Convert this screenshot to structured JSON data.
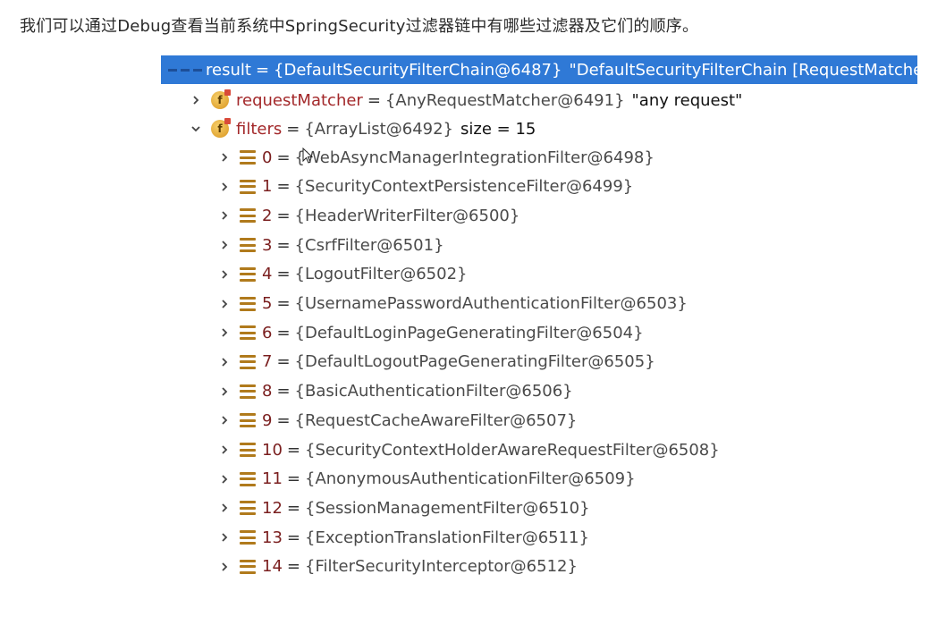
{
  "caption": "我们可以通过Debug查看当前系统中SpringSecurity过滤器链中有哪些过滤器及它们的顺序。",
  "result": {
    "name": "result",
    "value": "{DefaultSecurityFilterChain@6487}",
    "extra": "\"DefaultSecurityFilterChain [RequestMatche"
  },
  "request_matcher": {
    "name": "requestMatcher",
    "value": "{AnyRequestMatcher@6491}",
    "extra": "\"any request\""
  },
  "filters": {
    "name": "filters",
    "value": "{ArrayList@6492}",
    "extra": "size = 15",
    "items": [
      {
        "index": "0",
        "value": "{WebAsyncManagerIntegrationFilter@6498}"
      },
      {
        "index": "1",
        "value": "{SecurityContextPersistenceFilter@6499}"
      },
      {
        "index": "2",
        "value": "{HeaderWriterFilter@6500}"
      },
      {
        "index": "3",
        "value": "{CsrfFilter@6501}"
      },
      {
        "index": "4",
        "value": "{LogoutFilter@6502}"
      },
      {
        "index": "5",
        "value": "{UsernamePasswordAuthenticationFilter@6503}"
      },
      {
        "index": "6",
        "value": "{DefaultLoginPageGeneratingFilter@6504}"
      },
      {
        "index": "7",
        "value": "{DefaultLogoutPageGeneratingFilter@6505}"
      },
      {
        "index": "8",
        "value": "{BasicAuthenticationFilter@6506}"
      },
      {
        "index": "9",
        "value": "{RequestCacheAwareFilter@6507}"
      },
      {
        "index": "10",
        "value": "{SecurityContextHolderAwareRequestFilter@6508}"
      },
      {
        "index": "11",
        "value": "{AnonymousAuthenticationFilter@6509}"
      },
      {
        "index": "12",
        "value": "{SessionManagementFilter@6510}"
      },
      {
        "index": "13",
        "value": "{ExceptionTranslationFilter@6511}"
      },
      {
        "index": "14",
        "value": "{FilterSecurityInterceptor@6512}"
      }
    ]
  },
  "operator": "=",
  "icons": {
    "expand": "chevron-right-icon",
    "collapse": "chevron-down-icon",
    "field": "field-icon",
    "array_element": "array-element-icon"
  },
  "colors": {
    "selection": "#2f79d6",
    "field_name": "#a3282a",
    "value": "#4a4a4a"
  }
}
